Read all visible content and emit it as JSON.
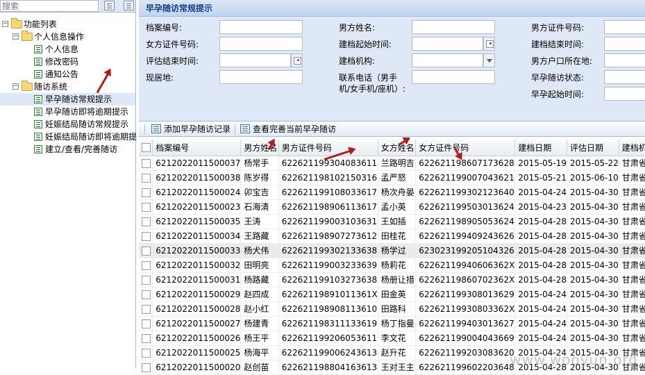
{
  "search": {
    "placeholder": "搜索"
  },
  "tree": {
    "root": "功能列表",
    "groups": [
      {
        "label": "个人信息操作",
        "items": [
          "个人信息",
          "修改密码",
          "通知公告"
        ]
      },
      {
        "label": "随访系统",
        "items": [
          "早孕随访常规提示",
          "早孕随访即将逾期提示",
          "妊娠结局随访常规提示",
          "妊娠结局随访即将逾期提",
          "建立/查看/完善随访"
        ]
      }
    ]
  },
  "panel": {
    "title": "早孕随访常规提示"
  },
  "form": {
    "col1": [
      "档案编号:",
      "女方证件号码:",
      "评估结束时间:",
      "现居地:"
    ],
    "col2": [
      "男方姓名:",
      "建档起始时间:",
      "建档机构:",
      "联系电话（男手机/女手机/座机）:"
    ],
    "col3": [
      "男方证件号码:",
      "建档结束时间:",
      "男方户口所在地:",
      "早孕随访状态:",
      "早孕起始时间:"
    ]
  },
  "toolbar": {
    "add": "添加早孕随访记录",
    "view": "查看完善当前早孕随访"
  },
  "grid": {
    "headers": [
      "档案编号",
      "男方姓名",
      "男方证件号码",
      "女方姓名",
      "女方证件号码",
      "建档日期",
      "评估日期",
      "建档机构"
    ],
    "rows": [
      [
        "6212022011500037",
        "杨常手",
        "62262119930408361​1",
        "兰路明吉",
        "622621198607173628",
        "2015-05-19",
        "2015-05-22",
        "甘肃省陇南"
      ],
      [
        "6212022011500038",
        "陈岁得",
        "622621198102150316",
        "孟严怒",
        "622621199007043621",
        "2015-05-21",
        "2015-06-10",
        "甘肃省陇南"
      ],
      [
        "6212022011500024",
        "卯宝吉",
        "622621199108033617",
        "杨次舟晏",
        "622621199302123640",
        "2015-04-24",
        "2015-04-30",
        "甘肃省陇南"
      ],
      [
        "6212022011500023",
        "石海清",
        "622621198906113617",
        "孟小英",
        "622621199503013624",
        "2015-04-23",
        "2015-04-30",
        "甘肃省陇南"
      ],
      [
        "6212022011500035",
        "王涛",
        "622621199003103631",
        "王如插",
        "622621198905053624",
        "2015-04-28",
        "2015-04-30",
        "甘肃省陇南"
      ],
      [
        "6212022011500034",
        "王路藏",
        "622621198907273612",
        "田桂花",
        "622621199409243626",
        "2015-04-28",
        "2015-04-30",
        "甘肃省陇南"
      ],
      [
        "6212022011500033",
        "杨犬伟",
        "622621199302133638",
        "杨学过",
        "623023199205104326",
        "2015-04-28",
        "2015-04-30",
        "甘肃省陇南"
      ],
      [
        "6212022011500032",
        "田明亮",
        "622621199003233639",
        "杨莉花",
        "62262119940606362X",
        "2015-04-28",
        "2015-04-30",
        "甘肃省陇南"
      ],
      [
        "6212022011500031",
        "杨路藏",
        "622621199103273638",
        "杨册让措",
        "62262119860702362X",
        "2015-04-28",
        "2015-04-30",
        "甘肃省陇南"
      ],
      [
        "6212022011500029",
        "赵四成",
        "62262119891011361X",
        "田金英",
        "622621199308013629",
        "2015-04-24",
        "2015-04-30",
        "甘肃省陇南"
      ],
      [
        "6212022011500028",
        "赵小红",
        "622621198908113610",
        "田路科",
        "62262119930803362X",
        "2015-04-24",
        "2015-04-30",
        "甘肃省陇南"
      ],
      [
        "6212022011500027",
        "杨建青",
        "622621198311133619",
        "杨丁指曼",
        "622621199403013627",
        "2015-04-24",
        "2015-04-30",
        "甘肃省陇南"
      ],
      [
        "6212022011500026",
        "杨王平",
        "622621199206053611",
        "李文花",
        "622621199004043669",
        "2015-04-24",
        "2015-04-30",
        "甘肃省陇南"
      ],
      [
        "6212022011500025",
        "杨海平",
        "622621199006243613",
        "赵升花",
        "622621199203083620",
        "2015-04-24",
        "2015-04-30",
        "甘肃省陇南"
      ],
      [
        "6212022011500020",
        "赵创苗",
        "622621198804163613",
        "王对王主",
        "622621199602203648",
        "2015-04-28",
        "2015-04-30",
        "甘肃省陇南"
      ]
    ]
  },
  "watermark": "www.wooyun.org"
}
